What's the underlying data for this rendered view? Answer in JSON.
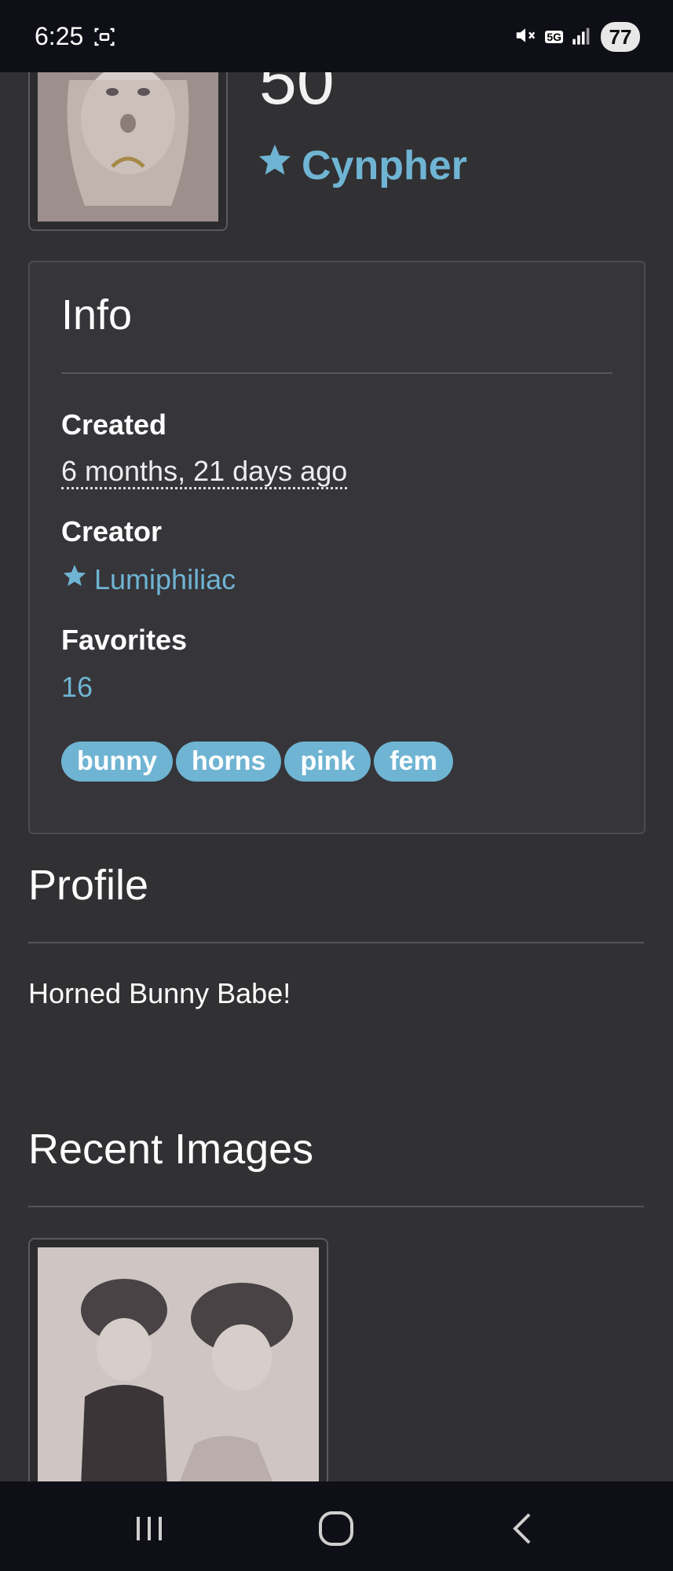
{
  "status_bar": {
    "time": "6:25",
    "network": "5G",
    "battery": "77"
  },
  "header": {
    "number": "50",
    "owner": "Cynpher"
  },
  "info": {
    "title": "Info",
    "created_label": "Created",
    "created_value": "6 months, 21 days ago",
    "creator_label": "Creator",
    "creator_value": "Lumiphiliac",
    "favorites_label": "Favorites",
    "favorites_value": "16",
    "tags": [
      "bunny",
      "horns",
      "pink",
      "fem"
    ]
  },
  "profile": {
    "title": "Profile",
    "text": "Horned Bunny Babe!"
  },
  "recent_images": {
    "title": "Recent Images"
  },
  "colors": {
    "background": "#313033",
    "card": "#363539",
    "accent": "#6fb4d3",
    "bars": "#0f0f17"
  },
  "icons": {
    "screenshot": "screen-capture-icon",
    "mute": "mute-icon",
    "signal": "signal-icon",
    "star": "star-icon",
    "recents": "recents-icon",
    "home": "home-icon",
    "back": "back-icon"
  }
}
